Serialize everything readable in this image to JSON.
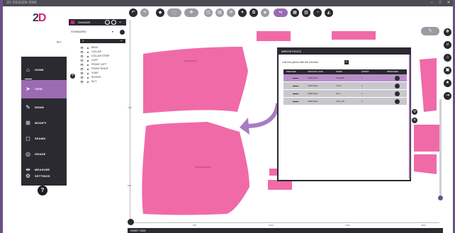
{
  "window": {
    "title": "2D DESIGN ONE",
    "minimize": "–",
    "maximize": "□",
    "close": "✕"
  },
  "logo": {
    "prefix": "2",
    "accent": "D"
  },
  "colors": {
    "accent": "#9b6bb2",
    "piece": "#f06aa8",
    "dark": "#2a2a30",
    "brand": "#d41f83"
  },
  "nav": {
    "items": [
      {
        "label": "HOME",
        "icon": "home-icon"
      },
      {
        "label": "VIEW",
        "icon": "cursor-icon",
        "active": true
      },
      {
        "label": "DRAW",
        "icon": "pencil-icon"
      },
      {
        "label": "MODIFY",
        "icon": "modify-icon"
      },
      {
        "label": "SEAMS",
        "icon": "seams-icon"
      },
      {
        "label": "GRADE",
        "icon": "grade-icon"
      },
      {
        "label": "MEASURE",
        "icon": "measure-icon"
      },
      {
        "label": "SETTINGS",
        "icon": "settings-icon"
      }
    ],
    "help": "?"
  },
  "tree": {
    "title": "Shirt0525",
    "standard": "STANDARD",
    "group": "1",
    "pieces": [
      "BACK",
      "COLLAR",
      "COLLAR STRIP",
      "CUFF",
      "FRONT LEFT",
      "FRONT RIGHT",
      "YOKE",
      "SLEEVE",
      "SLIT"
    ]
  },
  "modal": {
    "title": "MIRROR PIECES",
    "link_label": "Link this pieces with the mirrored",
    "checked": true,
    "columns": [
      "PREVIEW",
      "ORIGINAL SIZE",
      "NAME",
      "FABRIC",
      "MIRRORED"
    ],
    "rows": [
      {
        "size": "SIZE Basic",
        "name": "SLEEVE",
        "fabric": "1"
      },
      {
        "size": "SIZE Basic",
        "name": "CUFF",
        "fabric": "1"
      },
      {
        "size": "SIZE Basic",
        "name": "SLIT",
        "fabric": "1"
      },
      {
        "size": "SIZE Basic",
        "name": "COLLAR",
        "fabric": "1"
      }
    ]
  },
  "rulers": {
    "bottom": [
      "500",
      "1000",
      "1500",
      "2000"
    ],
    "left": [
      "-500",
      "500"
    ]
  },
  "bottom_bar": {
    "label": "SHIRT SIZE"
  }
}
